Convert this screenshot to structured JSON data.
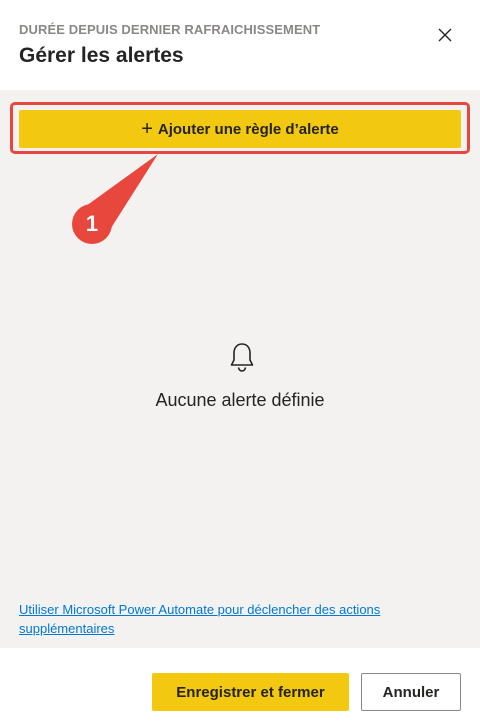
{
  "header": {
    "subtitle": "DURÉE DEPUIS DERNIER RAFRAICHISSEMENT",
    "title": "Gérer les alertes",
    "close_icon": "close-icon"
  },
  "main": {
    "add_rule_plus": "+",
    "add_rule_label": "Ajouter une règle d’alerte",
    "empty_icon": "bell-icon",
    "empty_message": "Aucune alerte définie",
    "automate_link": "Utiliser Microsoft Power Automate pour déclencher des actions supplémentaires"
  },
  "annotation": {
    "number": "1",
    "color": "#e8473d"
  },
  "footer": {
    "save_label": "Enregistrer et fermer",
    "cancel_label": "Annuler"
  },
  "colors": {
    "accent_yellow": "#f2c811",
    "link_blue": "#0078d4",
    "panel_bg": "#f3f2f1"
  }
}
